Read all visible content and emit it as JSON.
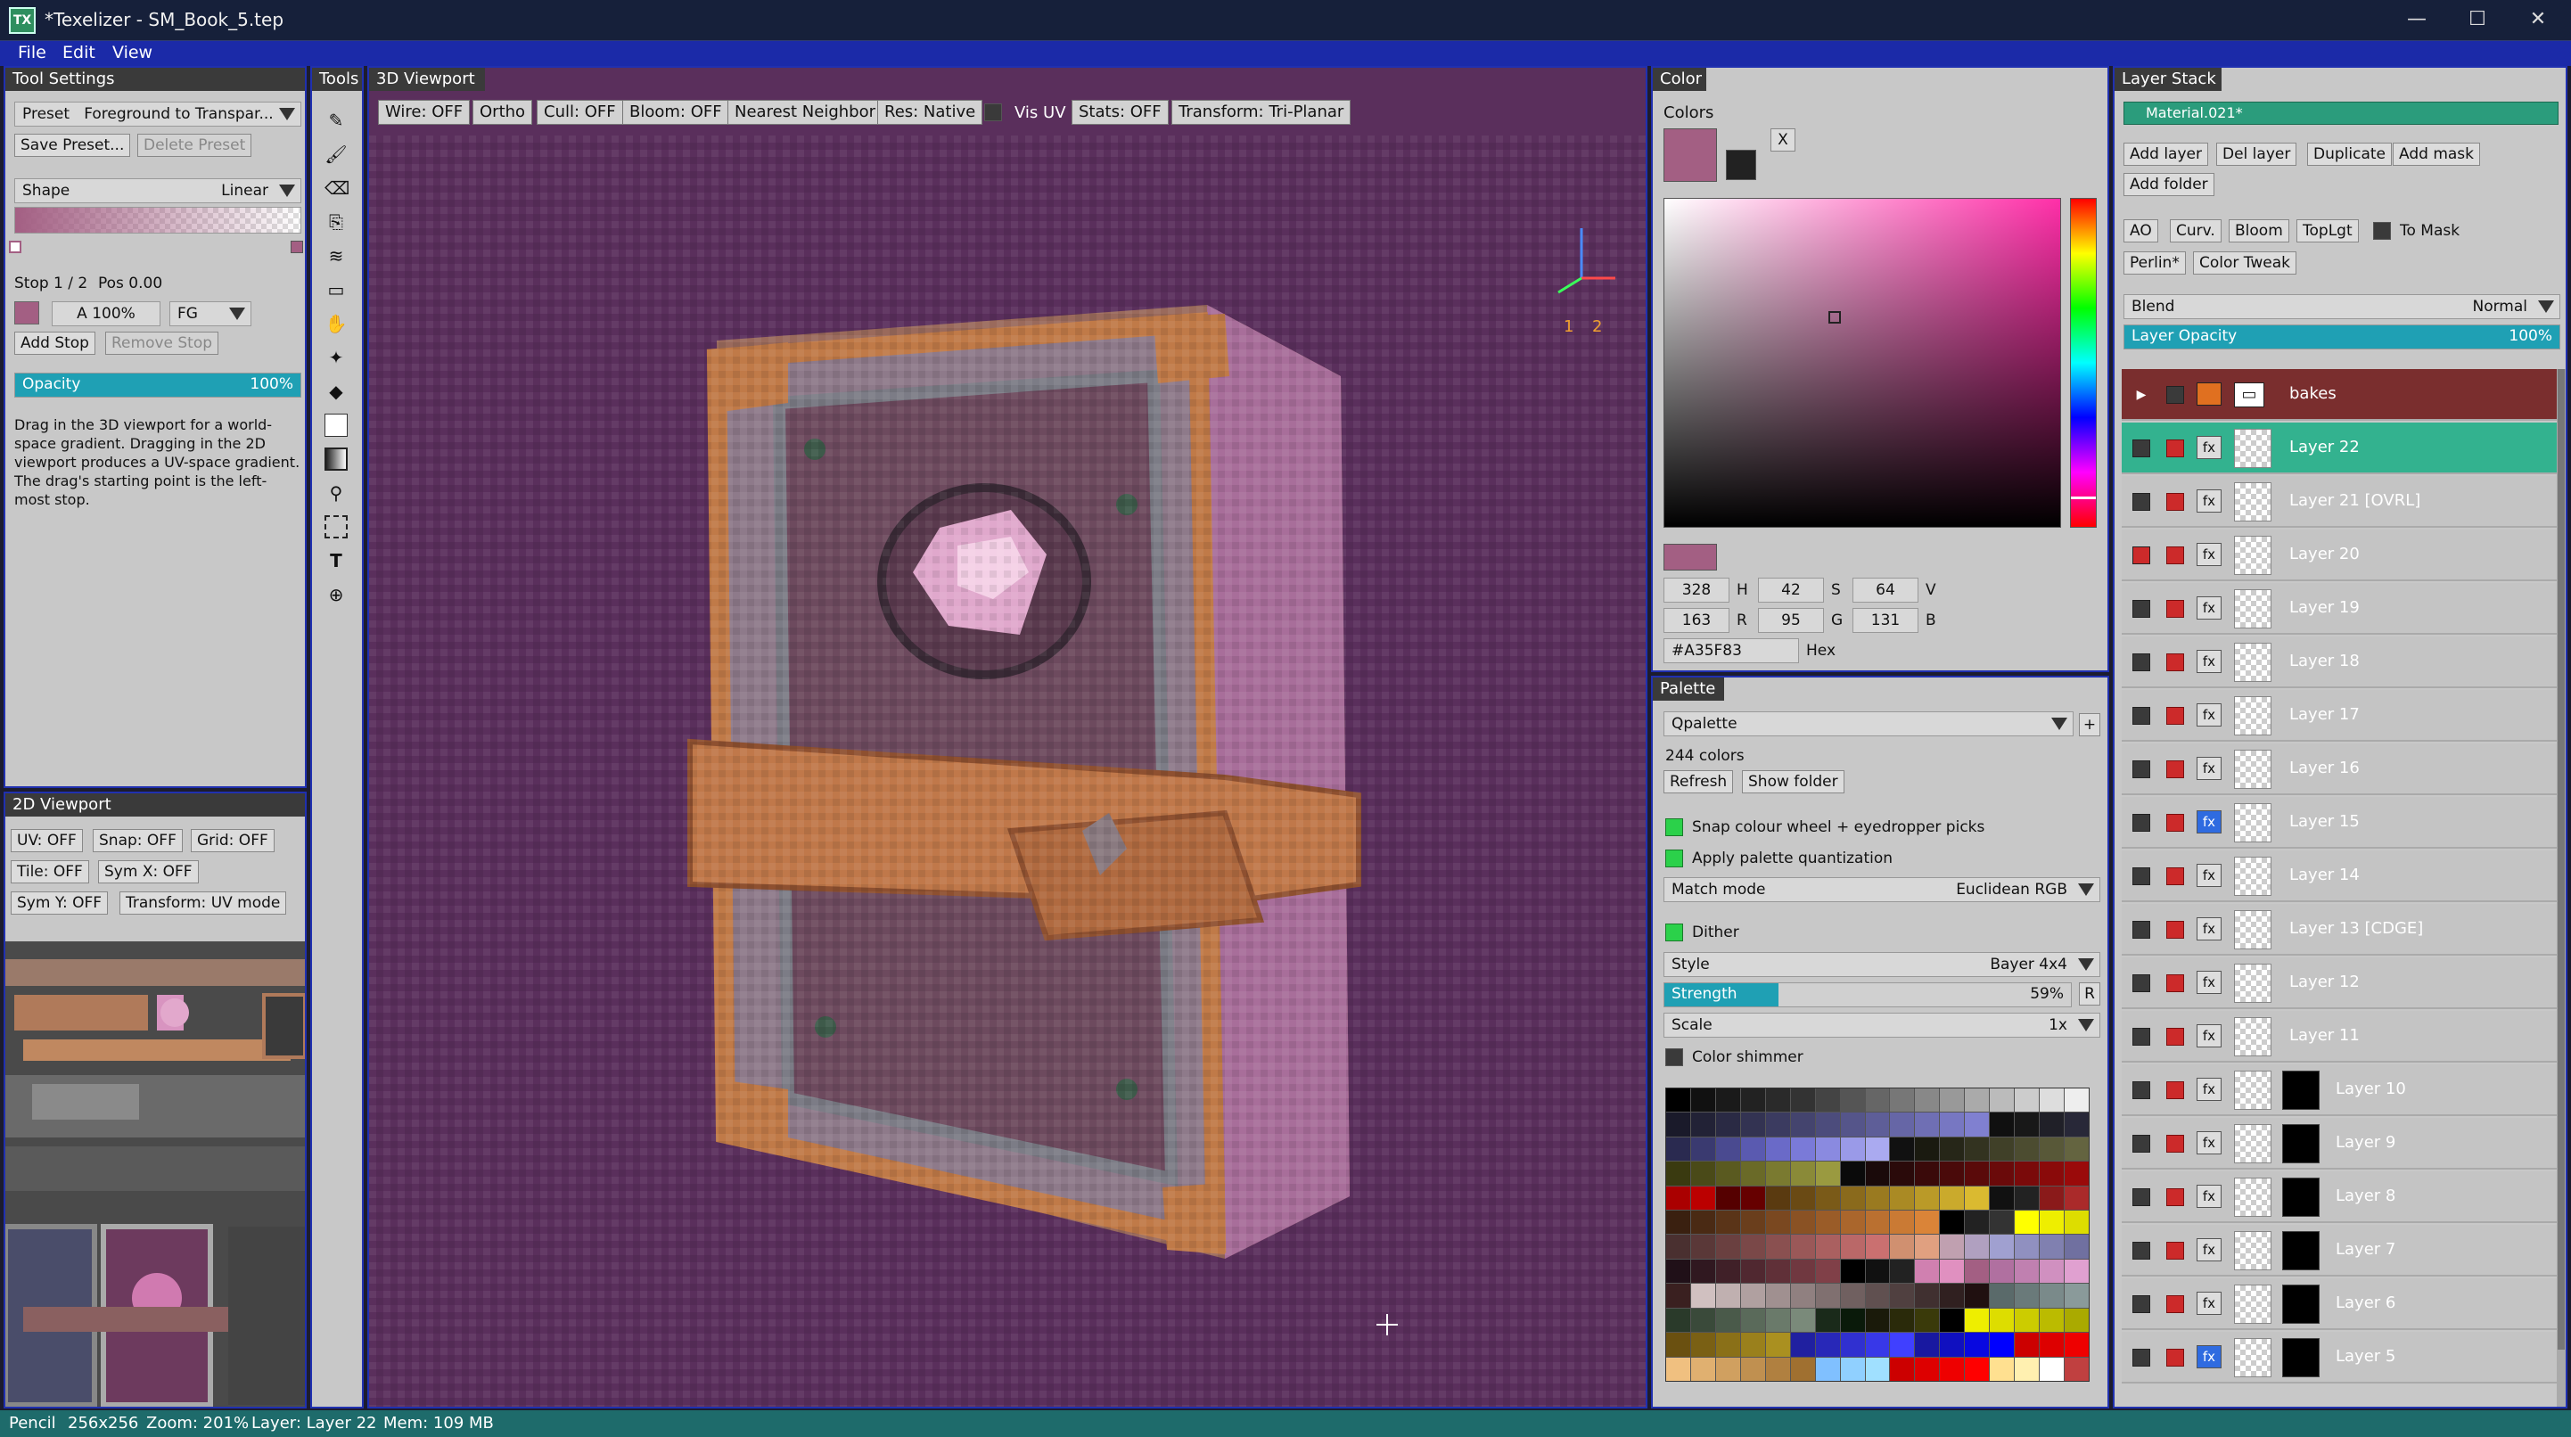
{
  "window": {
    "title": "*Texelizer - SM_Book_5.tep",
    "icon": "TX",
    "minimize": "—",
    "maximize": "☐",
    "close": "✕"
  },
  "menu": [
    "File",
    "Edit",
    "View"
  ],
  "tool_settings": {
    "header": "Tool Settings",
    "preset_label": "Preset",
    "preset_value": "Foreground to Transpar...",
    "save_preset": "Save Preset...",
    "delete_preset": "Delete Preset",
    "shape_label": "Shape",
    "shape_value": "Linear",
    "stop_text": "Stop 1 / 2",
    "pos_text": "Pos 0.00",
    "alpha_value": "A 100%",
    "fg_value": "FG",
    "add_stop": "Add Stop",
    "remove_stop": "Remove Stop",
    "opacity_label": "Opacity",
    "opacity_value": "100%",
    "opacity_level": 1.0,
    "help": "Drag in the 3D viewport for a world-space gradient. Dragging in the 2D viewport produces a UV-space gradient. The drag's starting point is the left-most stop."
  },
  "viewport2d": {
    "header": "2D Viewport",
    "buttons": [
      "UV: OFF",
      "Snap: OFF",
      "Grid: OFF",
      "Tile: OFF",
      "Sym X: OFF",
      "Sym Y: OFF",
      "Transform: UV mode"
    ]
  },
  "tools": {
    "header": "Tools"
  },
  "viewport3d": {
    "header": "3D Viewport",
    "toolbar": [
      "Wire: OFF",
      "Ortho",
      "Cull: OFF",
      "Bloom: OFF",
      "Nearest Neighbor",
      "Res: Native"
    ],
    "vis_uv": "Vis UV",
    "toolbar2": [
      "Stats: OFF",
      "Transform: Tri-Planar"
    ],
    "gizmo_labels": [
      "1",
      "2"
    ]
  },
  "color": {
    "header": "Color",
    "section": "Colors",
    "swap": "X",
    "current_color": "#A35F83",
    "h": "328",
    "s": "42",
    "v": "64",
    "r": "163",
    "g": "95",
    "b": "131",
    "h_label": "H",
    "s_label": "S",
    "v_label": "V",
    "r_label": "R",
    "g_label": "G",
    "b_label": "B",
    "hex": "#A35F83",
    "hex_label": "Hex"
  },
  "palette": {
    "header": "Palette",
    "name": "Qpalette",
    "add": "+",
    "count": "244 colors",
    "refresh": "Refresh",
    "show_folder": "Show folder",
    "snap": "Snap colour wheel + eyedropper picks",
    "apply": "Apply palette quantization",
    "match_label": "Match mode",
    "match_value": "Euclidean RGB",
    "dither": "Dither",
    "style_label": "Style",
    "style_value": "Bayer 4x4",
    "strength_label": "Strength",
    "strength_value": "59%",
    "strength_level": 0.28,
    "strength_reset": "R",
    "scale_label": "Scale",
    "scale_value": "1x",
    "shimmer": "Color shimmer"
  },
  "layer_stack": {
    "header": "Layer Stack",
    "material": "Material.021*",
    "buttons": [
      "Add layer",
      "Del layer",
      "Duplicate",
      "Add mask",
      "Add folder"
    ],
    "fx_buttons": [
      "AO",
      "Curv.",
      "Bloom",
      "TopLgt"
    ],
    "to_mask": "To Mask",
    "fx_buttons2": [
      "Perlin*",
      "Color Tweak"
    ],
    "blend_label": "Blend",
    "blend_value": "Normal",
    "opacity_label": "Layer Opacity",
    "opacity_value": "100%",
    "opacity_level": 1.0,
    "folder": "bakes",
    "layers": [
      "Layer 22",
      "Layer 21  [OVRL]",
      "Layer 20",
      "Layer 19",
      "Layer 18",
      "Layer 17",
      "Layer 16",
      "Layer 15",
      "Layer 14",
      "Layer 13  [CDGE]",
      "Layer 12",
      "Layer 11",
      "Layer 10",
      "Layer 9",
      "Layer 8",
      "Layer 7",
      "Layer 6",
      "Layer 5"
    ],
    "fx_label": "fx"
  },
  "status": [
    "Pencil",
    "256x256",
    "Zoom: 201%",
    "Layer: Layer 22",
    "Mem: 109 MB"
  ]
}
